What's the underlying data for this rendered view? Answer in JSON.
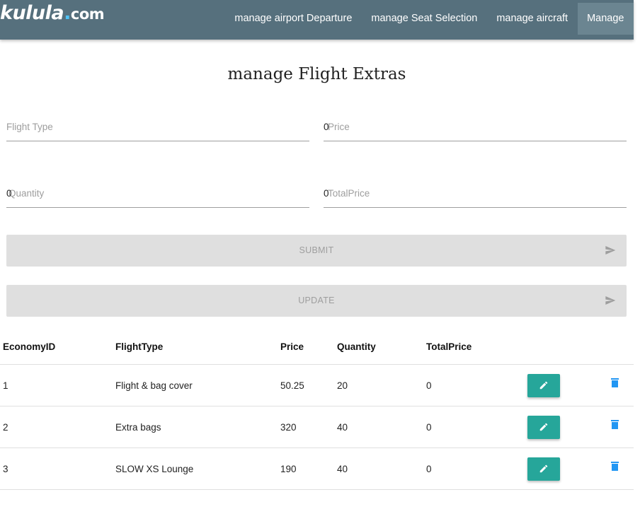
{
  "header": {
    "logo_main": "kulula",
    "logo_dot": ".",
    "logo_com": "com",
    "nav": [
      {
        "label": "manage airport Departure",
        "active": false
      },
      {
        "label": "manage Seat Selection",
        "active": false
      },
      {
        "label": "manage aircraft",
        "active": false
      },
      {
        "label": "Manage",
        "active": true
      }
    ],
    "bar_color": "#56707d",
    "active_color": "#6b8591"
  },
  "page": {
    "title": "manage Flight Extras"
  },
  "form": {
    "flight_type": {
      "label": "Flight Type",
      "value": ""
    },
    "price": {
      "label": "Price",
      "value": "0"
    },
    "quantity": {
      "label": "Quantity",
      "value": "0"
    },
    "total_price": {
      "label": "TotalPrice",
      "value": "0"
    },
    "submit_label": "SUBMIT",
    "update_label": "UPDATE",
    "button_icon": "send-icon"
  },
  "table": {
    "columns": [
      "EconomyID",
      "FlightType",
      "Price",
      "Quantity",
      "TotalPrice"
    ],
    "rows": [
      {
        "id": "1",
        "flight_type": "Flight & bag cover",
        "price": "50.25",
        "quantity": "20",
        "total_price": "0"
      },
      {
        "id": "2",
        "flight_type": "Extra bags",
        "price": "320",
        "quantity": "40",
        "total_price": "0"
      },
      {
        "id": "3",
        "flight_type": "SLOW XS Lounge",
        "price": "190",
        "quantity": "40",
        "total_price": "0"
      }
    ],
    "edit_icon": "pencil-icon",
    "delete_icon": "trash-icon",
    "edit_color": "#26a69a",
    "delete_color": "#2196f3"
  }
}
